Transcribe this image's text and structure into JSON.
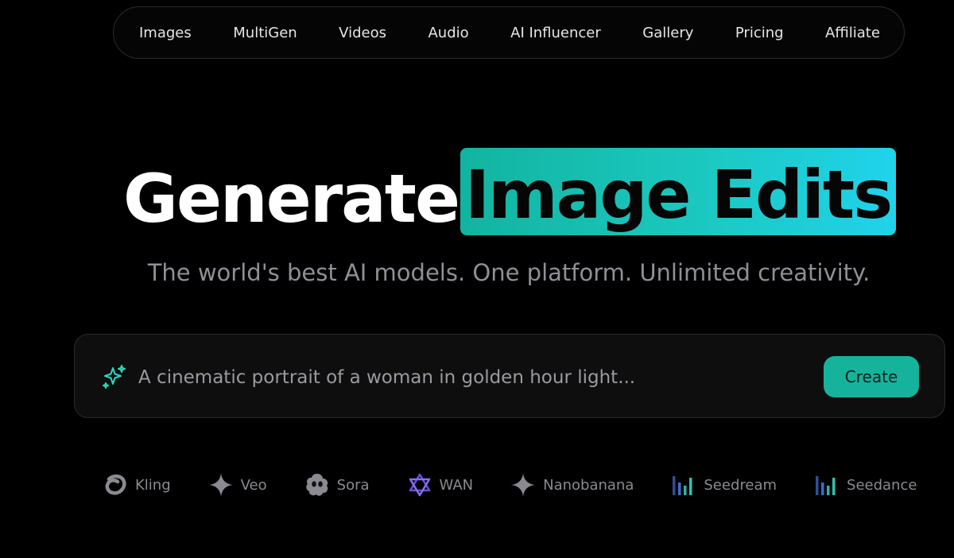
{
  "nav": {
    "items": [
      {
        "label": "Images"
      },
      {
        "label": "MultiGen"
      },
      {
        "label": "Videos"
      },
      {
        "label": "Audio"
      },
      {
        "label": "AI Influencer"
      },
      {
        "label": "Gallery"
      },
      {
        "label": "Pricing"
      },
      {
        "label": "Affiliate"
      }
    ]
  },
  "hero": {
    "title_prefix": "Generate",
    "title_highlight": "Image Edits",
    "highlight_gradient": [
      "#12b4a0",
      "#20d3ec"
    ],
    "subtitle": "The world's best AI models. One platform. Unlimited creativity."
  },
  "prompt": {
    "icon": "sparkle-icon",
    "placeholder": "A cinematic portrait of a woman in golden hour light...",
    "value": "",
    "create_label": "Create",
    "accent_color": "#16b39c"
  },
  "models": [
    {
      "label": "Kling",
      "icon": "kling-logo-icon"
    },
    {
      "label": "Veo",
      "icon": "veo-star-icon"
    },
    {
      "label": "Sora",
      "icon": "sora-logo-icon"
    },
    {
      "label": "WAN",
      "icon": "wan-logo-icon"
    },
    {
      "label": "Nanobanana",
      "icon": "nanobanana-star-icon"
    },
    {
      "label": "Seedream",
      "icon": "seedream-bars-icon"
    },
    {
      "label": "Seedance",
      "icon": "seedance-bars-icon"
    }
  ]
}
